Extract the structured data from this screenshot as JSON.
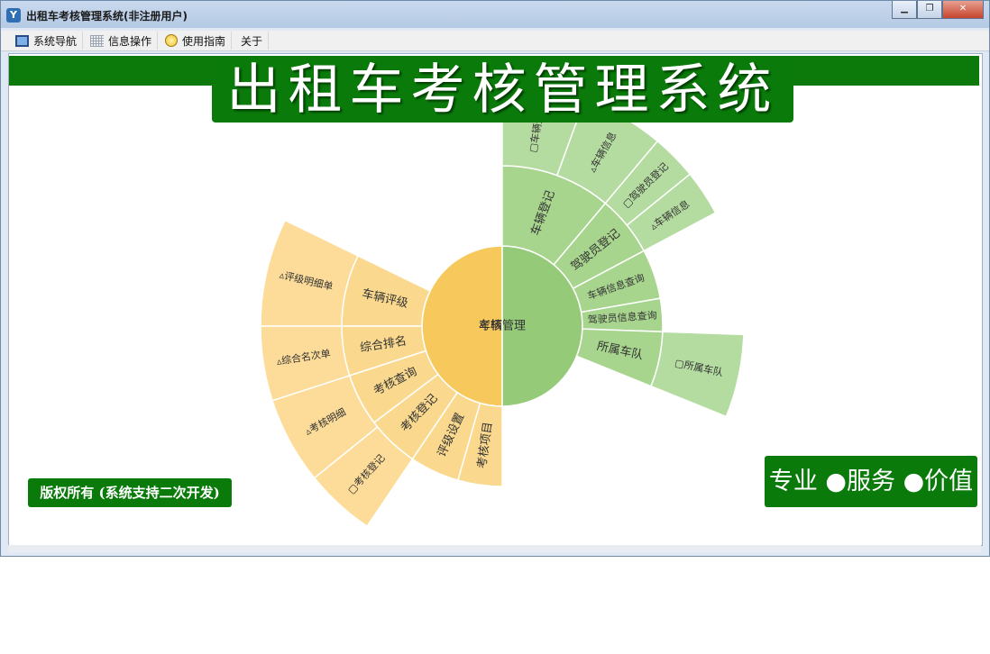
{
  "window": {
    "title": "出租车考核管理系统(非注册用户)",
    "minimize_glyph": "▁",
    "maximize_glyph": "❐",
    "close_glyph": "✕",
    "app_icon_letter": "Y"
  },
  "menu": [
    {
      "label": "系统导航",
      "icon": "monitor-icon"
    },
    {
      "label": "信息操作",
      "icon": "grid-icon"
    },
    {
      "label": "使用指南",
      "icon": "bulb-icon"
    },
    {
      "label": "关于",
      "icon": ""
    }
  ],
  "banner": {
    "title": "出租车考核管理系统"
  },
  "footer": {
    "copyright": "版权所有 (系统支持二次开发)",
    "slogan": "专业 ●服务 ●价值"
  },
  "colors": {
    "brand_green": "#0a7a0a",
    "orange_center": "#f7c85c",
    "orange_ring": "#fad98e",
    "orange_outer": "#fcdc98",
    "green_center": "#95cb78",
    "green_ring": "#a8d58e",
    "green_outer": "#b4dca0"
  },
  "sunburst": {
    "left_root": {
      "label": "考核管理",
      "children": [
        {
          "label": "车辆评级",
          "children": [
            {
              "label": "▵评级明细单"
            }
          ]
        },
        {
          "label": "综合排名",
          "children": [
            {
              "label": "▵综合名次单"
            }
          ]
        },
        {
          "label": "考核查询",
          "children": [
            {
              "label": "▵考核明细"
            }
          ]
        },
        {
          "label": "考核登记",
          "children": [
            {
              "label": "▢考核登记"
            }
          ]
        },
        {
          "label": "评级设置",
          "children": []
        },
        {
          "label": "考核项目",
          "children": []
        }
      ]
    },
    "right_root": {
      "label": "车辆管理",
      "children": [
        {
          "label": "车辆登记",
          "children": [
            {
              "label": "▢车辆登记"
            },
            {
              "label": "▵车辆信息"
            }
          ]
        },
        {
          "label": "驾驶员登记",
          "children": [
            {
              "label": "▢驾驶员登记"
            },
            {
              "label": "▵车辆信息"
            }
          ]
        },
        {
          "label": "车辆信息查询",
          "children": []
        },
        {
          "label": "驾驶员信息查询",
          "children": []
        },
        {
          "label": "所属车队",
          "children": [
            {
              "label": "▢所属车队"
            }
          ]
        }
      ]
    }
  }
}
